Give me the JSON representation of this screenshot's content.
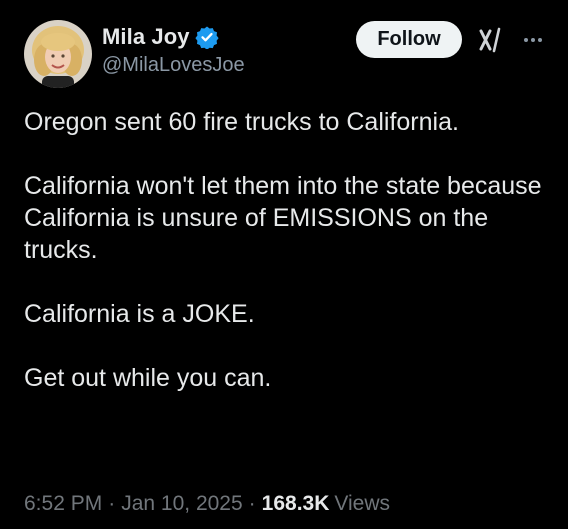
{
  "author": {
    "display_name": "Mila Joy",
    "handle": "@MilaLovesJoe",
    "verified": true,
    "verified_color": "#1d9bf0"
  },
  "actions": {
    "follow_label": "Follow",
    "grok_icon": "grok-icon",
    "more_icon": "more-icon"
  },
  "tweet": {
    "paragraphs": [
      "Oregon sent 60 fire trucks to California.",
      "California won't let them into the state because California is unsure of EMISSIONS on the trucks.",
      "California is a JOKE.",
      "Get out while you can."
    ]
  },
  "meta": {
    "time": "6:52 PM",
    "separator": "·",
    "date": "Jan 10, 2025",
    "views_count": "168.3K",
    "views_label": "Views"
  },
  "colors": {
    "background": "#000000",
    "text_primary": "#e7e9ea",
    "text_secondary": "#71767b",
    "follow_bg": "#eff3f4"
  }
}
